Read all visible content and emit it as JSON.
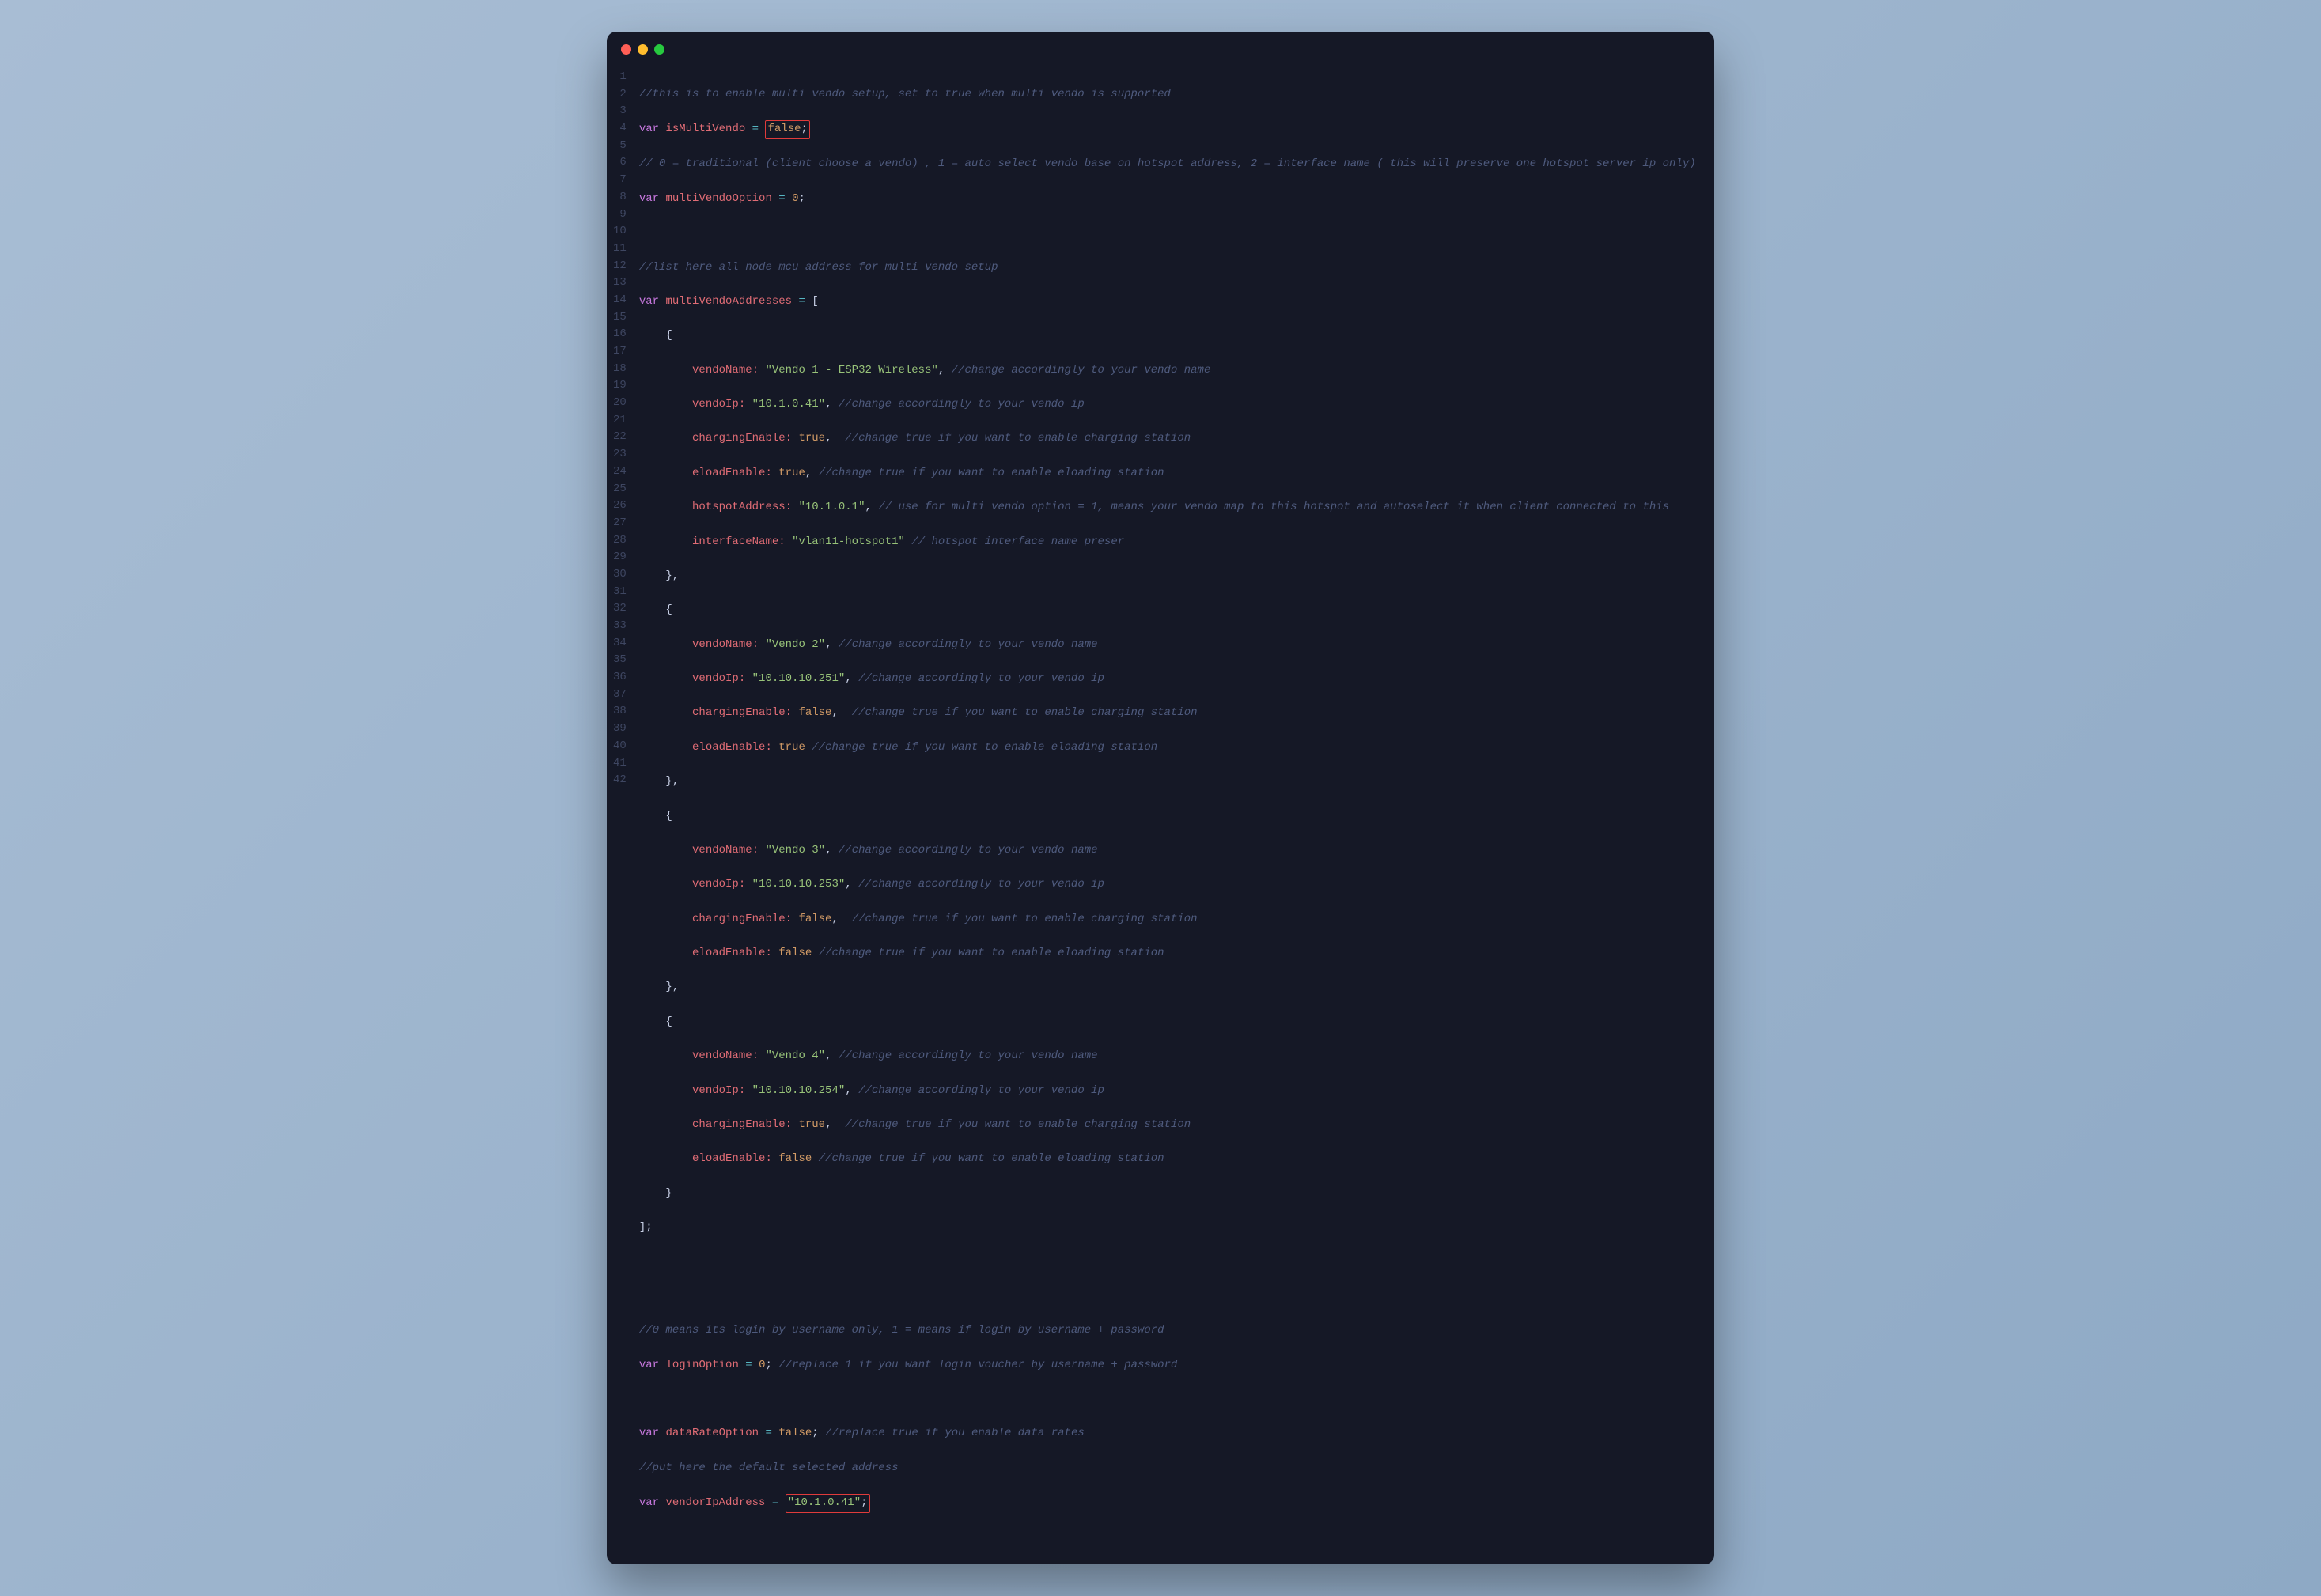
{
  "window_controls": [
    "close",
    "minimize",
    "zoom"
  ],
  "line_numbers": [
    "1",
    "2",
    "3",
    "4",
    "5",
    "6",
    "7",
    "8",
    "9",
    "10",
    "11",
    "12",
    "13",
    "14",
    "15",
    "16",
    "17",
    "18",
    "19",
    "20",
    "21",
    "22",
    "23",
    "24",
    "25",
    "26",
    "27",
    "28",
    "29",
    "30",
    "31",
    "32",
    "33",
    "34",
    "35",
    "36",
    "37",
    "38",
    "39",
    "40",
    "41",
    "42"
  ],
  "colors": {
    "background": "#151826",
    "comment": "#4e5a7d",
    "keyword": "#c678dd",
    "identifier": "#e06c75",
    "operator": "#56b6c2",
    "string": "#98c379",
    "number": "#d19a66",
    "highlight_box": "#e03b3b"
  },
  "c": {
    "l1": "//this is to enable multi vendo setup, set to true when multi vendo is supported",
    "l2_var": "var",
    "l2_id": "isMultiVendo",
    "l2_eq": "=",
    "l2_val": "false",
    "l2_semi": ";",
    "l3": "// 0 = traditional (client choose a vendo) , 1 = auto select vendo base on hotspot address, 2 = interface name ( this will preserve one hotspot server ip only)",
    "l4_var": "var",
    "l4_id": "multiVendoOption",
    "l4_eq": "=",
    "l4_val": "0",
    "l4_semi": ";",
    "l6": "//list here all node mcu address for multi vendo setup",
    "l7_var": "var",
    "l7_id": "multiVendoAddresses",
    "l7_eq": "=",
    "l7_br": "[",
    "l8": "    {",
    "l9_k": "        vendoName:",
    "l9_v": "\"Vendo 1 - ESP32 Wireless\"",
    "l9_p": ",",
    "l9_c": "//change accordingly to your vendo name",
    "l10_k": "        vendoIp:",
    "l10_v": "\"10.1.0.41\"",
    "l10_p": ",",
    "l10_c": "//change accordingly to your vendo ip",
    "l11_k": "        chargingEnable:",
    "l11_v": "true",
    "l11_p": ",",
    "l11_c": "//change true if you want to enable charging station",
    "l12_k": "        eloadEnable:",
    "l12_v": "true",
    "l12_p": ",",
    "l12_c": "//change true if you want to enable eloading station",
    "l13_k": "        hotspotAddress:",
    "l13_v": "\"10.1.0.1\"",
    "l13_p": ",",
    "l13_c": "// use for multi vendo option = 1, means your vendo map to this hotspot and autoselect it when client connected to this",
    "l14_k": "        interfaceName:",
    "l14_v": "\"vlan11-hotspot1\"",
    "l14_c": "// hotspot interface name preser",
    "l15": "    },",
    "l16": "    {",
    "l17_k": "        vendoName:",
    "l17_v": "\"Vendo 2\"",
    "l17_p": ",",
    "l17_c": "//change accordingly to your vendo name",
    "l18_k": "        vendoIp:",
    "l18_v": "\"10.10.10.251\"",
    "l18_p": ",",
    "l18_c": "//change accordingly to your vendo ip",
    "l19_k": "        chargingEnable:",
    "l19_v": "false",
    "l19_p": ",",
    "l19_c": "//change true if you want to enable charging station",
    "l20_k": "        eloadEnable:",
    "l20_v": "true",
    "l20_c": "//change true if you want to enable eloading station",
    "l21": "    },",
    "l22": "    {",
    "l23_k": "        vendoName:",
    "l23_v": "\"Vendo 3\"",
    "l23_p": ",",
    "l23_c": "//change accordingly to your vendo name",
    "l24_k": "        vendoIp:",
    "l24_v": "\"10.10.10.253\"",
    "l24_p": ",",
    "l24_c": "//change accordingly to your vendo ip",
    "l25_k": "        chargingEnable:",
    "l25_v": "false",
    "l25_p": ",",
    "l25_c": "//change true if you want to enable charging station",
    "l26_k": "        eloadEnable:",
    "l26_v": "false",
    "l26_c": "//change true if you want to enable eloading station",
    "l27": "    },",
    "l28": "    {",
    "l29_k": "        vendoName:",
    "l29_v": "\"Vendo 4\"",
    "l29_p": ",",
    "l29_c": "//change accordingly to your vendo name",
    "l30_k": "        vendoIp:",
    "l30_v": "\"10.10.10.254\"",
    "l30_p": ",",
    "l30_c": "//change accordingly to your vendo ip",
    "l31_k": "        chargingEnable:",
    "l31_v": "true",
    "l31_p": ",",
    "l31_c": "//change true if you want to enable charging station",
    "l32_k": "        eloadEnable:",
    "l32_v": "false",
    "l32_c": "//change true if you want to enable eloading station",
    "l33": "    }",
    "l34": "];",
    "l37": "//0 means its login by username only, 1 = means if login by username + password",
    "l38_var": "var",
    "l38_id": "loginOption",
    "l38_eq": "=",
    "l38_val": "0",
    "l38_semi": ";",
    "l38_c": "//replace 1 if you want login voucher by username + password",
    "l40_var": "var",
    "l40_id": "dataRateOption",
    "l40_eq": "=",
    "l40_val": "false",
    "l40_semi": ";",
    "l40_c": "//replace true if you enable data rates",
    "l41": "//put here the default selected address",
    "l42_var": "var",
    "l42_id": "vendorIpAddress",
    "l42_eq": "=",
    "l42_val": "\"10.1.0.41\"",
    "l42_semi": ";"
  }
}
